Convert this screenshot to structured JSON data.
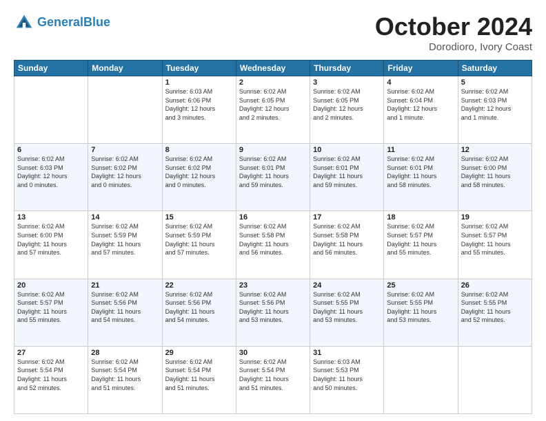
{
  "header": {
    "logo_line1": "General",
    "logo_line2": "Blue",
    "month": "October 2024",
    "location": "Dorodioro, Ivory Coast"
  },
  "weekdays": [
    "Sunday",
    "Monday",
    "Tuesday",
    "Wednesday",
    "Thursday",
    "Friday",
    "Saturday"
  ],
  "weeks": [
    [
      {
        "day": "",
        "info": ""
      },
      {
        "day": "",
        "info": ""
      },
      {
        "day": "1",
        "info": "Sunrise: 6:03 AM\nSunset: 6:06 PM\nDaylight: 12 hours\nand 3 minutes."
      },
      {
        "day": "2",
        "info": "Sunrise: 6:02 AM\nSunset: 6:05 PM\nDaylight: 12 hours\nand 2 minutes."
      },
      {
        "day": "3",
        "info": "Sunrise: 6:02 AM\nSunset: 6:05 PM\nDaylight: 12 hours\nand 2 minutes."
      },
      {
        "day": "4",
        "info": "Sunrise: 6:02 AM\nSunset: 6:04 PM\nDaylight: 12 hours\nand 1 minute."
      },
      {
        "day": "5",
        "info": "Sunrise: 6:02 AM\nSunset: 6:03 PM\nDaylight: 12 hours\nand 1 minute."
      }
    ],
    [
      {
        "day": "6",
        "info": "Sunrise: 6:02 AM\nSunset: 6:03 PM\nDaylight: 12 hours\nand 0 minutes."
      },
      {
        "day": "7",
        "info": "Sunrise: 6:02 AM\nSunset: 6:02 PM\nDaylight: 12 hours\nand 0 minutes."
      },
      {
        "day": "8",
        "info": "Sunrise: 6:02 AM\nSunset: 6:02 PM\nDaylight: 12 hours\nand 0 minutes."
      },
      {
        "day": "9",
        "info": "Sunrise: 6:02 AM\nSunset: 6:01 PM\nDaylight: 11 hours\nand 59 minutes."
      },
      {
        "day": "10",
        "info": "Sunrise: 6:02 AM\nSunset: 6:01 PM\nDaylight: 11 hours\nand 59 minutes."
      },
      {
        "day": "11",
        "info": "Sunrise: 6:02 AM\nSunset: 6:01 PM\nDaylight: 11 hours\nand 58 minutes."
      },
      {
        "day": "12",
        "info": "Sunrise: 6:02 AM\nSunset: 6:00 PM\nDaylight: 11 hours\nand 58 minutes."
      }
    ],
    [
      {
        "day": "13",
        "info": "Sunrise: 6:02 AM\nSunset: 6:00 PM\nDaylight: 11 hours\nand 57 minutes."
      },
      {
        "day": "14",
        "info": "Sunrise: 6:02 AM\nSunset: 5:59 PM\nDaylight: 11 hours\nand 57 minutes."
      },
      {
        "day": "15",
        "info": "Sunrise: 6:02 AM\nSunset: 5:59 PM\nDaylight: 11 hours\nand 57 minutes."
      },
      {
        "day": "16",
        "info": "Sunrise: 6:02 AM\nSunset: 5:58 PM\nDaylight: 11 hours\nand 56 minutes."
      },
      {
        "day": "17",
        "info": "Sunrise: 6:02 AM\nSunset: 5:58 PM\nDaylight: 11 hours\nand 56 minutes."
      },
      {
        "day": "18",
        "info": "Sunrise: 6:02 AM\nSunset: 5:57 PM\nDaylight: 11 hours\nand 55 minutes."
      },
      {
        "day": "19",
        "info": "Sunrise: 6:02 AM\nSunset: 5:57 PM\nDaylight: 11 hours\nand 55 minutes."
      }
    ],
    [
      {
        "day": "20",
        "info": "Sunrise: 6:02 AM\nSunset: 5:57 PM\nDaylight: 11 hours\nand 55 minutes."
      },
      {
        "day": "21",
        "info": "Sunrise: 6:02 AM\nSunset: 5:56 PM\nDaylight: 11 hours\nand 54 minutes."
      },
      {
        "day": "22",
        "info": "Sunrise: 6:02 AM\nSunset: 5:56 PM\nDaylight: 11 hours\nand 54 minutes."
      },
      {
        "day": "23",
        "info": "Sunrise: 6:02 AM\nSunset: 5:56 PM\nDaylight: 11 hours\nand 53 minutes."
      },
      {
        "day": "24",
        "info": "Sunrise: 6:02 AM\nSunset: 5:55 PM\nDaylight: 11 hours\nand 53 minutes."
      },
      {
        "day": "25",
        "info": "Sunrise: 6:02 AM\nSunset: 5:55 PM\nDaylight: 11 hours\nand 53 minutes."
      },
      {
        "day": "26",
        "info": "Sunrise: 6:02 AM\nSunset: 5:55 PM\nDaylight: 11 hours\nand 52 minutes."
      }
    ],
    [
      {
        "day": "27",
        "info": "Sunrise: 6:02 AM\nSunset: 5:54 PM\nDaylight: 11 hours\nand 52 minutes."
      },
      {
        "day": "28",
        "info": "Sunrise: 6:02 AM\nSunset: 5:54 PM\nDaylight: 11 hours\nand 51 minutes."
      },
      {
        "day": "29",
        "info": "Sunrise: 6:02 AM\nSunset: 5:54 PM\nDaylight: 11 hours\nand 51 minutes."
      },
      {
        "day": "30",
        "info": "Sunrise: 6:02 AM\nSunset: 5:54 PM\nDaylight: 11 hours\nand 51 minutes."
      },
      {
        "day": "31",
        "info": "Sunrise: 6:03 AM\nSunset: 5:53 PM\nDaylight: 11 hours\nand 50 minutes."
      },
      {
        "day": "",
        "info": ""
      },
      {
        "day": "",
        "info": ""
      }
    ]
  ]
}
